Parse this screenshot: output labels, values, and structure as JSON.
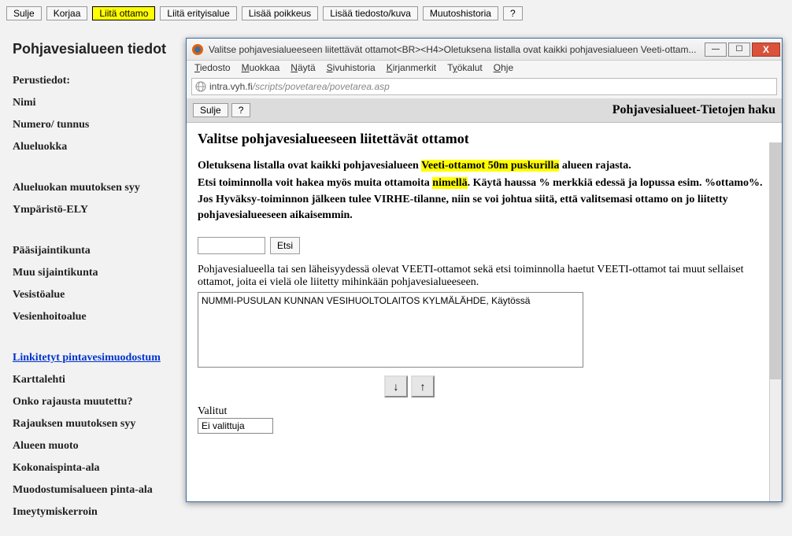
{
  "toolbar": {
    "close": "Sulje",
    "fix": "Korjaa",
    "attach_intake": "Liitä ottamo",
    "attach_special": "Liitä erityisalue",
    "add_exception": "Lisää poikkeus",
    "add_file": "Lisää tiedosto/kuva",
    "history": "Muutoshistoria",
    "help": "?"
  },
  "page_title": "Pohjavesialueen tiedot",
  "fields": {
    "basic": "Perustiedot:",
    "name": "Nimi",
    "number": "Numero/ tunnus",
    "area_class": "Alueluokka",
    "area_class_change_reason": "Alueluokan muutoksen syy",
    "ymp_ely": "Ympäristö-ELY",
    "main_location": "Pääsijaintikunta",
    "other_location": "Muu sijaintikunta",
    "water_system": "Vesistöalue",
    "water_mgmt": "Vesienhoitoalue",
    "linked_surface": "Linkitetyt pintavesimuodostum",
    "map_sheet": "Karttalehti",
    "boundary_changed": "Onko rajausta muutettu?",
    "boundary_reason": "Rajauksen muutoksen syy",
    "area_shape": "Alueen muoto",
    "total_area": "Kokonaispinta-ala",
    "formation_area": "Muodostumisalueen pinta-ala",
    "infil_coeff": "Imeytymiskerroin"
  },
  "popup": {
    "window_title": "Valitse pohjavesialueeseen liitettävät ottamot<BR><H4>Oletuksena listalla ovat kaikki pohjavesialueen Veeti-ottam...",
    "menu": {
      "file": "Tiedosto",
      "edit": "Muokkaa",
      "view": "Näytä",
      "history": "Sivuhistoria",
      "bookmarks": "Kirjanmerkit",
      "tools": "Työkalut",
      "help": "Ohje"
    },
    "url_host": "intra.vyh.fi",
    "url_path": "/scripts/povetarea/povetarea.asp",
    "inner_close": "Sulje",
    "inner_help": "?",
    "inner_title": "Pohjavesialueet-Tietojen haku",
    "section_title": "Valitse pohjavesialueeseen liitettävät ottamot",
    "para1_pre": "Oletuksena listalla ovat kaikki pohjavesialueen ",
    "para1_hl": "Veeti-ottamot 50m puskurilla",
    "para1_post": " alueen rajasta.",
    "para2_pre": "Etsi toiminnolla voit hakea myös muita ottamoita ",
    "para2_hl": "nimellä",
    "para2_post": ". Käytä haussa % merkkiä edessä ja lopussa esim. %ottamo%.",
    "para3": "Jos Hyväksy-toiminnon jälkeen tulee VIRHE-tilanne, niin se voi johtua siitä, että valitsemasi ottamo on jo liitetty pohjavesialueeseen aikaisemmin.",
    "search_btn": "Etsi",
    "list_desc": "Pohjavesialueella tai sen läheisyydessä olevat VEETI-ottamot sekä etsi toiminnolla haetut VEETI-ottamot tai muut sellaiset ottamot, joita ei vielä ole liitetty mihinkään pohjavesialueeseen.",
    "list_item": "NUMMI-PUSULAN KUNNAN VESIHUOLTOLAITOS KYLMÄLÄHDE, Käytössä",
    "selected_label": "Valitut",
    "selected_none": "Ei valittuja",
    "arrow_down": "↓",
    "arrow_up": "↑",
    "min": "—",
    "max": "☐",
    "close_x": "X"
  }
}
